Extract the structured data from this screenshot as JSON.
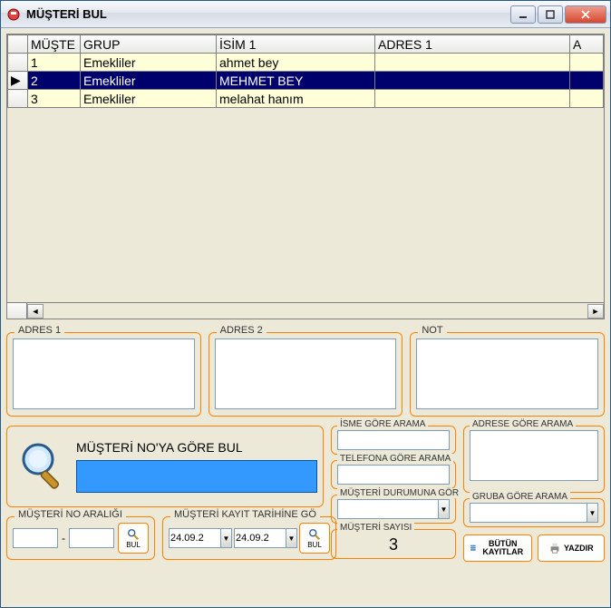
{
  "window": {
    "title": "MÜŞTERİ BUL"
  },
  "grid": {
    "columns": [
      "MÜŞTE",
      "GRUP",
      "İSİM 1",
      "ADRES 1",
      "A"
    ],
    "rows": [
      {
        "no": "1",
        "grup": "Emekliler",
        "isim": "ahmet bey",
        "adres": "",
        "selected": false
      },
      {
        "no": "2",
        "grup": "Emekliler",
        "isim": "MEHMET BEY",
        "adres": "",
        "selected": true
      },
      {
        "no": "3",
        "grup": "Emekliler",
        "isim": "melahat hanım",
        "adres": "",
        "selected": false
      }
    ]
  },
  "memos": {
    "adres1_label": "ADRES 1",
    "adres2_label": "ADRES 2",
    "not_label": "NOT",
    "adres1": "",
    "adres2": "",
    "not": ""
  },
  "search_main": {
    "title": "MÜŞTERİ NO'YA GÖRE BUL",
    "value": ""
  },
  "range": {
    "label": "MÜŞTERİ NO ARALIĞI",
    "from": "",
    "to": "",
    "find_label": "BUL"
  },
  "daterange": {
    "label": "MÜŞTERİ KAYIT TARİHİNE GÖ",
    "from": "24.09.2",
    "to": "24.09.2",
    "find_label": "BUL"
  },
  "filters": {
    "isim_label": "İSME GÖRE ARAMA",
    "isim": "",
    "tel_label": "TELEFONA GÖRE ARAMA",
    "tel": "",
    "durum_label": "MÜŞTERİ DURUMUNA GÖR",
    "durum": "",
    "adres_label": "ADRESE GÖRE ARAMA",
    "adres": "",
    "grup_label": "GRUBA GÖRE ARAMA",
    "grup": ""
  },
  "count": {
    "label": "MÜŞTERİ SAYISI",
    "value": "3"
  },
  "buttons": {
    "all": "BÜTÜN KAYITLAR",
    "print": "YAZDIR"
  }
}
